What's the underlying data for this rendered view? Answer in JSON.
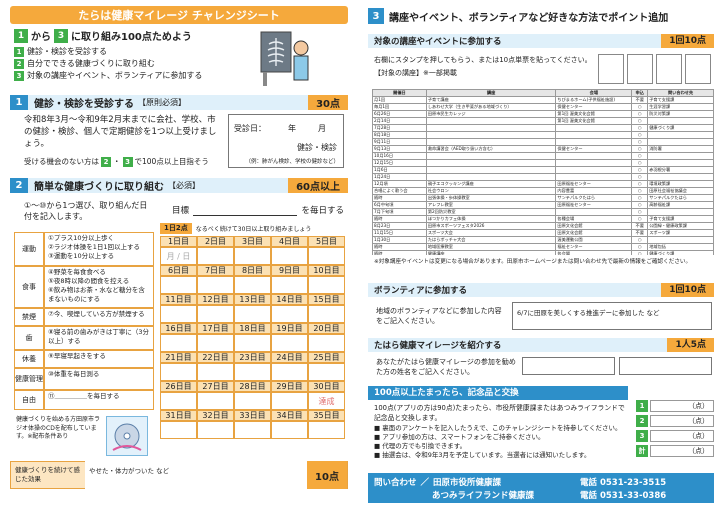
{
  "left": {
    "title": "たらは健康マイレージ チャレンジシート",
    "intro_from": "から",
    "intro_num1": "1",
    "intro_num2": "3",
    "intro_to": "に取り組み100点ためよう",
    "intro_items": [
      "健診・検診を受診する",
      "自分でできる健康づくりに取り組む",
      "対象の講座やイベント、ボランティアに参加する"
    ],
    "s1": {
      "num": "1",
      "title": "健診・検診を受診する",
      "required": "【原則必須】",
      "points": "30点",
      "body": "令和8年3月～令和9年2月末までに会社、学校、市の健診・検診、個人で定期健診を1つ以上受けましょう。",
      "note": "受ける機会のない方は",
      "note2": "で100点以上目指そう",
      "date_label": "受診日：",
      "year": "年",
      "month": "月",
      "kind": "健診・検診",
      "kind_note": "（例：肺がん検診、学校の健診など）"
    },
    "s2": {
      "num": "2",
      "title": "簡単な健康づくりに取り組む",
      "required": "【必須】",
      "points": "60点以上",
      "body": "①～⑩から1つ選び、取り組んだ日付を記入します。",
      "goal_label": "目標",
      "goal_suffix": "を毎日する",
      "badge": "1日2点",
      "badge_note": "なるべく続けて30日以上取り組みましょう",
      "categories": [
        {
          "label": "運動",
          "text": "①プラス10分以上歩く\n②ラジオ体操を1日1回以上する\n③運動を10分以上する"
        },
        {
          "label": "食事",
          "text": "④野菜を毎食食べる\n⑤夜8時以降の間食を控える\n⑥飲み物はお茶・水など糖分を含まないものにする"
        },
        {
          "label": "禁煙",
          "text": "⑦今、喫煙している方が禁煙する"
        },
        {
          "label": "歯",
          "text": "⑧寝る前の歯みがきは丁寧に（3分以上）する"
        },
        {
          "label": "休養",
          "text": "⑨早寝早起きをする"
        },
        {
          "label": "健康管理",
          "text": "⑩体重を毎日測る"
        },
        {
          "label": "自由",
          "text": "⑪＿＿＿＿＿を毎日する"
        }
      ],
      "days": [
        [
          "1日目",
          "2日目",
          "3日目",
          "4日目",
          "5日目"
        ],
        [
          "6日目",
          "7日目",
          "8日目",
          "9日目",
          "10日目"
        ],
        [
          "11日目",
          "12日目",
          "13日目",
          "14日目",
          "15日目"
        ],
        [
          "16日目",
          "17日目",
          "18日目",
          "19日目",
          "20日目"
        ],
        [
          "21日目",
          "22日目",
          "23日目",
          "24日目",
          "25日目"
        ],
        [
          "26日目",
          "27日目",
          "28日目",
          "29日目",
          "30日目"
        ],
        [
          "31日目",
          "32日目",
          "33日目",
          "34日目",
          "35日目"
        ]
      ],
      "example": "月 / 日",
      "achieved": "達成",
      "radio_note": "健康づくりを始める方田原市ラジオ体操のCDを配布しています。※配布条件あり"
    },
    "effect_label": "健康づくりを続けて感じた効果",
    "effect_example": "やせた・体力がついた など",
    "effect_points": "10点"
  },
  "right": {
    "num": "3",
    "title": "講座やイベント、ボランティアなど好きな方法でポイント追加",
    "events": {
      "title": "対象の講座やイベントに参加する",
      "points": "1回10点",
      "desc": "右欄にスタンプを押してもらう、または10点単票を貼ってください。",
      "list_label": "【対象の講座】※一部掲載",
      "headers": [
        "開催日",
        "講座",
        "会場",
        "申込",
        "問い合わせ先"
      ],
      "rows": [
        [
          "月1回",
          "子育て講座",
          "ちびまるホーム(子供福祉施設)",
          "不要",
          "子育て支援課"
        ],
        [
          "毎月1回",
          "しあわせ大学（生き甲斐がある地域づくり）",
          "保健センター",
          "○",
          "生涯学習課"
        ],
        [
          "6月26日",
          "田原市民生カレッジ",
          "第1回 渥美文化会館",
          "○",
          "防災対策課"
        ],
        [
          "2月14日",
          "",
          "第1回 渥美文化会館",
          "○",
          ""
        ],
        [
          "7月28日",
          "",
          "",
          "○",
          "健康づくり課"
        ],
        [
          "8月18日",
          "",
          "",
          "○",
          ""
        ],
        [
          "9月11日",
          "",
          "",
          "○",
          ""
        ],
        [
          "9月13日",
          "救命講習会（AED取り扱い方含む）",
          "保健センター",
          "○",
          "消防署"
        ],
        [
          "10月16日",
          "",
          "",
          "○",
          ""
        ],
        [
          "12月15日",
          "",
          "",
          "○",
          ""
        ],
        [
          "1月6日",
          "",
          "",
          "○",
          "赤羽根分署"
        ],
        [
          "1月24日",
          "",
          "",
          "○",
          ""
        ],
        [
          "12月頃",
          "親子エコクッキング講座",
          "田原福祉センター",
          "○",
          "環境政策課"
        ],
        [
          "合唱によく歌う会",
          "社会ウロン",
          "内容豊富",
          "○",
          "田原社会福祉協議会"
        ],
        [
          "随時",
          "出張体操・歩体操教室",
          "サンテパルクたはら",
          "○",
          "サンテパルクたはら"
        ],
        [
          "6月中旬頃",
          "アレフレ教室",
          "田原福祉センター",
          "○",
          "高齢福祉課"
        ],
        [
          "7月下旬頃",
          "第2回防災教室",
          "",
          "○",
          ""
        ],
        [
          "随時",
          "ほつかりカフェ体操",
          "各種会場",
          "○",
          "子育て支援課"
        ],
        [
          "8月23日",
          "田原市スポーツフェスタ2026",
          "田原文化会館",
          "不要",
          "公園緑・健康政策課"
        ],
        [
          "11月15日",
          "スポーツ大会",
          "田原文化会館",
          "不要",
          "スポーツ課"
        ],
        [
          "1月30日",
          "たはらボッチャ大会",
          "渥美運動公園",
          "○",
          ""
        ],
        [
          "随時",
          "地域医療教室",
          "福祉センター",
          "○",
          "地域包括"
        ],
        [
          "随時",
          "健康講座",
          "各会場",
          "○",
          "健康づくり課"
        ]
      ],
      "foot": "※対象講座やイベントは変更になる場合があります。田原市ホームページまたは問い合わせ先で最新の情報をご確認ください。"
    },
    "volunteer": {
      "title": "ボランティアに参加する",
      "points": "1回10点",
      "desc": "地域のボランティアなどに参加した内容をご記入ください。",
      "example": "6/7に田原を美しくする推進デーに参加した など"
    },
    "introduce": {
      "title": "たはら健康マイレージを紹介する",
      "points": "1人5点",
      "desc": "あなたがたはら健康マイレージの参加を勧めた方の姓名をご記入ください。"
    },
    "prize": {
      "title": "100点以上たまったら、記念品と交換",
      "text1": "100点(アプリの方は90点)たまったら、市役所健康課またはあつみライフランドで記念品と交換します。",
      "bullets": [
        "裏面のアンケートを記入したうえで、このチャレンジシートを持参してください。",
        "アプリ参加の方は、スマートフォンをご持参ください。",
        "代理の方でも引換できます。",
        "抽選会は、令和9年3月を予定しています。当選者には通知いたします。"
      ],
      "score_rows": [
        {
          "n": "1",
          "unit": "点"
        },
        {
          "n": "2",
          "unit": "点"
        },
        {
          "n": "3",
          "unit": "点"
        },
        {
          "n": "計",
          "unit": "点"
        }
      ]
    },
    "contact": {
      "label": "問い合わせ",
      "org1": "田原市役所健康課",
      "tel1": "電話 0531-23-3515",
      "org2": "あつみライフランド健康課",
      "tel2": "電話 0531-33-0386"
    }
  }
}
